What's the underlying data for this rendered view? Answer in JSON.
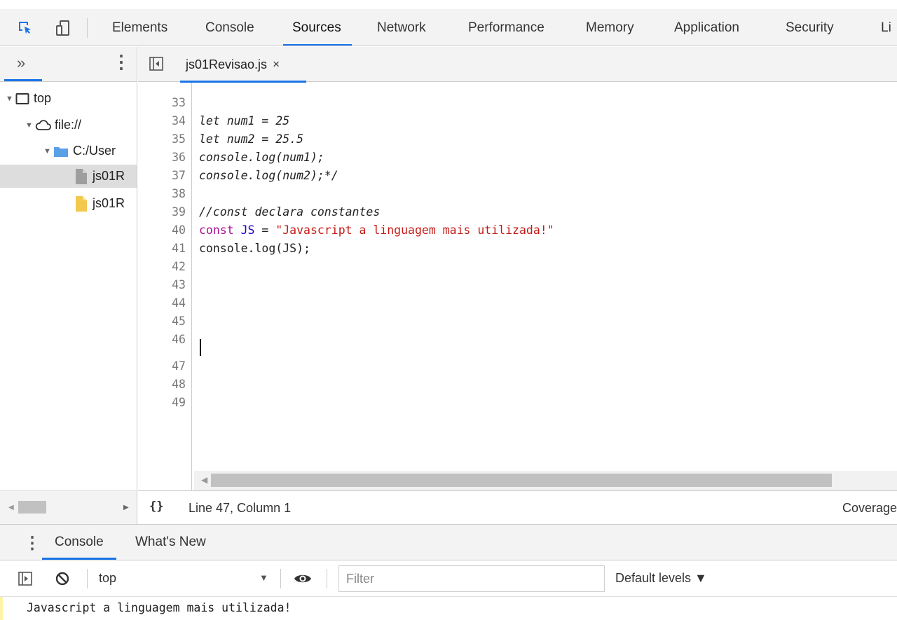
{
  "main_tabs": [
    "Elements",
    "Console",
    "Sources",
    "Network",
    "Performance",
    "Memory",
    "Application",
    "Security",
    "Li"
  ],
  "active_main_tab": "Sources",
  "navigator": {
    "more_label": "»",
    "tree": {
      "frame": "top",
      "origin": "file://",
      "folder": "C:/User",
      "file_1": "js01R",
      "file_2": "js01R"
    }
  },
  "editor": {
    "tab_label": "js01Revisao.js",
    "close_glyph": "×",
    "lines": [
      {
        "n": "33",
        "text": "let num1 = 25"
      },
      {
        "n": "34",
        "text": "let num2 = 25.5"
      },
      {
        "n": "35",
        "text": "console.log(num1);"
      },
      {
        "n": "36",
        "text": "console.log(num2);*/"
      },
      {
        "n": "37",
        "text": ""
      },
      {
        "n": "38",
        "text": "//const declara constantes"
      },
      {
        "n": "39",
        "kw": "const",
        "var": "JS",
        "op": " = ",
        "str": "\"Javascript a linguagem mais utilizada!\""
      },
      {
        "n": "40",
        "text": "console.log(JS);"
      },
      {
        "n": "41",
        "text": ""
      },
      {
        "n": "42",
        "text": ""
      },
      {
        "n": "43",
        "text": ""
      },
      {
        "n": "44",
        "text": ""
      },
      {
        "n": "45",
        "text": ""
      },
      {
        "n": "46",
        "text": ""
      },
      {
        "n": "47",
        "text": ""
      },
      {
        "n": "48",
        "text": ""
      },
      {
        "n": "49",
        "text": ""
      }
    ]
  },
  "status": {
    "pretty_print": "{}",
    "position": "Line 47, Column 1",
    "coverage": "Coverage"
  },
  "drawer": {
    "tabs": [
      "Console",
      "What's New"
    ],
    "context": "top",
    "filter_placeholder": "Filter",
    "levels": "Default levels ▼",
    "message": "Javascript a linguagem mais utilizada!"
  },
  "colors": {
    "accent": "#1a73e8",
    "comment": "#236e25",
    "keyword": "#aa0d91",
    "variable": "#1c00cf",
    "string": "#c41a16"
  }
}
